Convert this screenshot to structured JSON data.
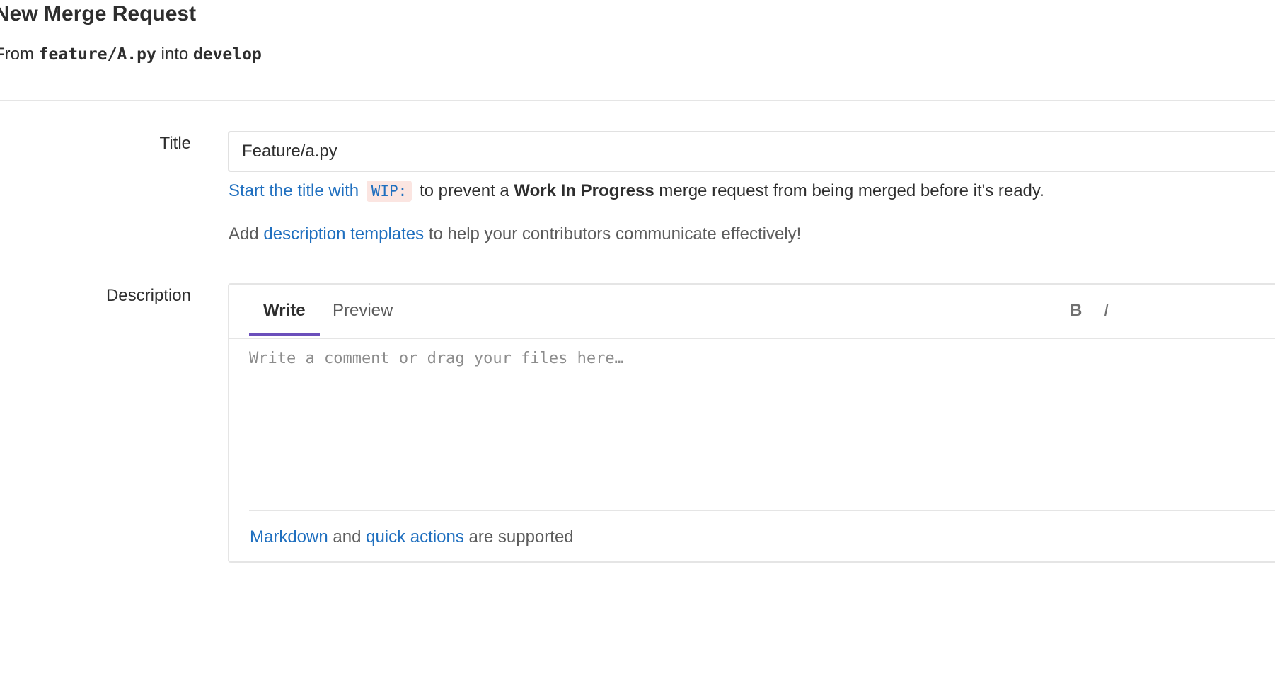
{
  "page": {
    "title": "New Merge Request",
    "from_prefix": "From",
    "source_branch": "feature/A.py",
    "into_word": "into",
    "target_branch": "develop"
  },
  "form": {
    "title_label": "Title",
    "title_value": "Feature/a.py",
    "wip_hint": {
      "link_text": "Start the title with",
      "code": "WIP:",
      "text_before_bold": "to prevent a",
      "bold_text": "Work In Progress",
      "text_after_bold": "merge request from being merged before it's ready."
    },
    "templates_hint": {
      "prefix": "Add",
      "link_text": "description templates",
      "suffix": "to help your contributors communicate effectively!"
    },
    "description_label": "Description",
    "editor": {
      "tabs": {
        "write": "Write",
        "preview": "Preview"
      },
      "active_tab": "write",
      "toolbar": {
        "bold": "B",
        "italic": "I"
      },
      "placeholder": "Write a comment or drag your files here…",
      "footer": {
        "markdown_link": "Markdown",
        "and_word": "and",
        "quick_actions_link": "quick actions",
        "suffix": "are supported"
      }
    }
  },
  "colors": {
    "link": "#1f6fbf",
    "active_tab_underline": "#6b4fbb",
    "wip_code_background": "#fbe5e1",
    "border": "#e5e5e5"
  }
}
